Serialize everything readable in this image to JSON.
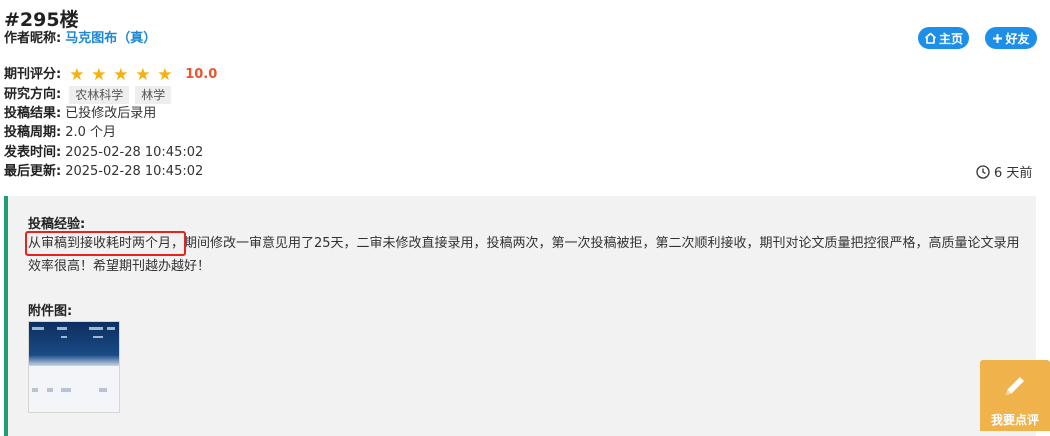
{
  "post": {
    "floor": "#295楼",
    "author_label": "作者昵称:",
    "author_name": "马克图布（真）",
    "home_button": "主页",
    "friend_button": "好友",
    "rating_label": "期刊评分:",
    "rating_stars": 5,
    "rating_value": "10.0",
    "direction_label": "研究方向:",
    "direction_tags": [
      "农林科学",
      "林学"
    ],
    "result_label": "投稿结果:",
    "result_value": "已投修改后录用",
    "cycle_label": "投稿周期:",
    "cycle_value": "2.0 个月",
    "publish_label": "发表时间:",
    "publish_value": "2025-02-28 10:45:02",
    "update_label": "最后更新:",
    "update_value": "2025-02-28 10:45:02",
    "time_ago": "6 天前"
  },
  "experience": {
    "title": "投稿经验:",
    "highlighted": "从审稿到接收耗时两个月，",
    "text": "期间修改一审意见用了25天，二审未修改直接录用，投稿两次，第一次投稿被拒，第二次顺利接收，期刊对论文质量把控很严格，高质量论文录用效率很高！希望期刊越办越好！"
  },
  "attachment": {
    "title": "附件图:"
  },
  "review_button": {
    "label": "我要点评"
  },
  "colors": {
    "link_blue": "#1e88d6",
    "pill_blue": "#1e8fe8",
    "star": "#f6b10c",
    "rating": "#f0522c",
    "accent_green": "#1d9e76",
    "highlight_red": "#e5231f",
    "review_orange": "#f0b24a"
  },
  "icons": {
    "home": "home-icon",
    "friend": "plus-icon",
    "clock": "clock-icon",
    "pen": "pencil-icon",
    "star": "star-icon"
  }
}
